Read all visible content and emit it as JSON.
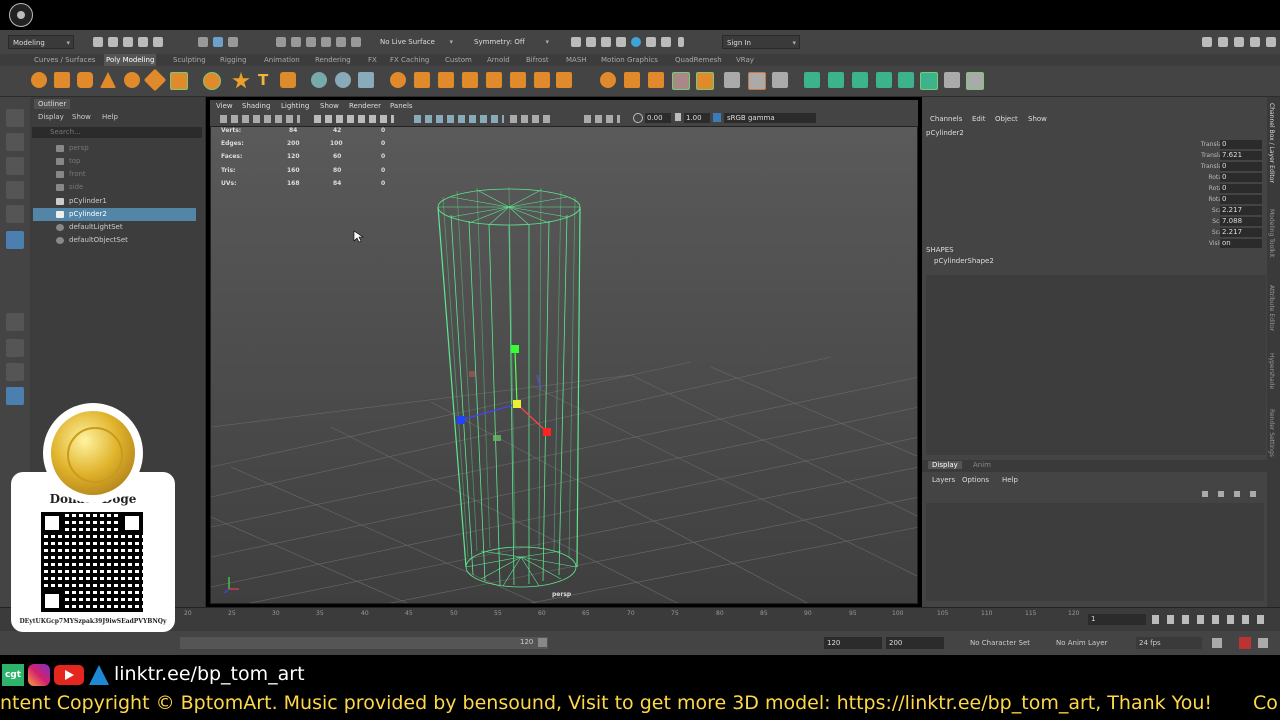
{
  "status_line": {
    "workspace": "Modeling",
    "live_surface": "No Live Surface",
    "symmetry": "Symmetry: Off",
    "sign_in": "Sign In"
  },
  "shelf_tabs": [
    "Curves / Surfaces",
    "Poly Modeling",
    "Sculpting",
    "Rigging",
    "Animation",
    "Rendering",
    "FX",
    "FX Caching",
    "Custom",
    "Arnold",
    "Bifrost",
    "MASH",
    "Motion Graphics",
    "QuadRemesh",
    "VRay"
  ],
  "shelf_active": "Poly Modeling",
  "outliner": {
    "title": "Outliner",
    "menu": [
      "Display",
      "Show",
      "Help"
    ],
    "search_placeholder": "Search...",
    "items": [
      {
        "label": "persp",
        "state": "dim"
      },
      {
        "label": "top",
        "state": "dim"
      },
      {
        "label": "front",
        "state": "dim"
      },
      {
        "label": "side",
        "state": "dim"
      },
      {
        "label": "pCylinder1",
        "state": "normal"
      },
      {
        "label": "pCylinder2",
        "state": "selected"
      },
      {
        "label": "defaultLightSet",
        "state": "normal"
      },
      {
        "label": "defaultObjectSet",
        "state": "normal"
      }
    ]
  },
  "viewport": {
    "menu": [
      "View",
      "Shading",
      "Lighting",
      "Show",
      "Renderer",
      "Panels"
    ],
    "exposure": "0.00",
    "gamma": "1.00",
    "color_space": "sRGB gamma",
    "camera_label": "persp",
    "hud": [
      {
        "label": "Verts:",
        "a": "84",
        "b": "42",
        "c": "0"
      },
      {
        "label": "Edges:",
        "a": "200",
        "b": "100",
        "c": "0"
      },
      {
        "label": "Faces:",
        "a": "120",
        "b": "60",
        "c": "0"
      },
      {
        "label": "Tris:",
        "a": "160",
        "b": "80",
        "c": "0"
      },
      {
        "label": "UVs:",
        "a": "168",
        "b": "84",
        "c": "0"
      }
    ]
  },
  "channel_box": {
    "menu": [
      "Channels",
      "Edit",
      "Object",
      "Show"
    ],
    "object": "pCylinder2",
    "channels": [
      {
        "label": "Translate X",
        "value": "0"
      },
      {
        "label": "Translate Y",
        "value": "7.621"
      },
      {
        "label": "Translate Z",
        "value": "0"
      },
      {
        "label": "Rotate X",
        "value": "0"
      },
      {
        "label": "Rotate Y",
        "value": "0"
      },
      {
        "label": "Rotate Z",
        "value": "0"
      },
      {
        "label": "Scale X",
        "value": "2.217"
      },
      {
        "label": "Scale Y",
        "value": "7.088"
      },
      {
        "label": "Scale Z",
        "value": "2.217"
      },
      {
        "label": "Visibility",
        "value": "on"
      }
    ],
    "shapes_header": "SHAPES",
    "shape": "pCylinderShape2"
  },
  "layer_editor": {
    "tabs": [
      "Display",
      "Anim"
    ],
    "menu": [
      "Layers",
      "Options",
      "Help"
    ]
  },
  "side_tabs": [
    "Channel Box / Layer Editor",
    "Modeling Toolkit",
    "Attribute Editor",
    "Hypershade",
    "Render Settings"
  ],
  "timeline": {
    "ticks": [
      "20",
      "25",
      "30",
      "35",
      "40",
      "45",
      "50",
      "55",
      "60",
      "65",
      "70",
      "75",
      "80",
      "85",
      "90",
      "95",
      "100",
      "105",
      "110",
      "115",
      "120"
    ],
    "current_frame": "1"
  },
  "range": {
    "end_slider": "120",
    "anim_end": "120",
    "play_end": "200",
    "character_set": "No Character Set",
    "anim_layer": "No Anim Layer",
    "fps": "24 fps"
  },
  "donate": {
    "title": "Donate Doge",
    "address": "DEytUKGcp7MYSzpak39J9iwSEadPVYBNQy"
  },
  "footer": {
    "link": "linktr.ee/bp_tom_art",
    "icon_badge": "cgt",
    "ticker": "ntent Copyright © BptomArt. Music provided by bensound, Visit to get more 3D model: https://linktr.ee/bp_tom_art, Thank You!",
    "ticker_tail": "Co"
  }
}
